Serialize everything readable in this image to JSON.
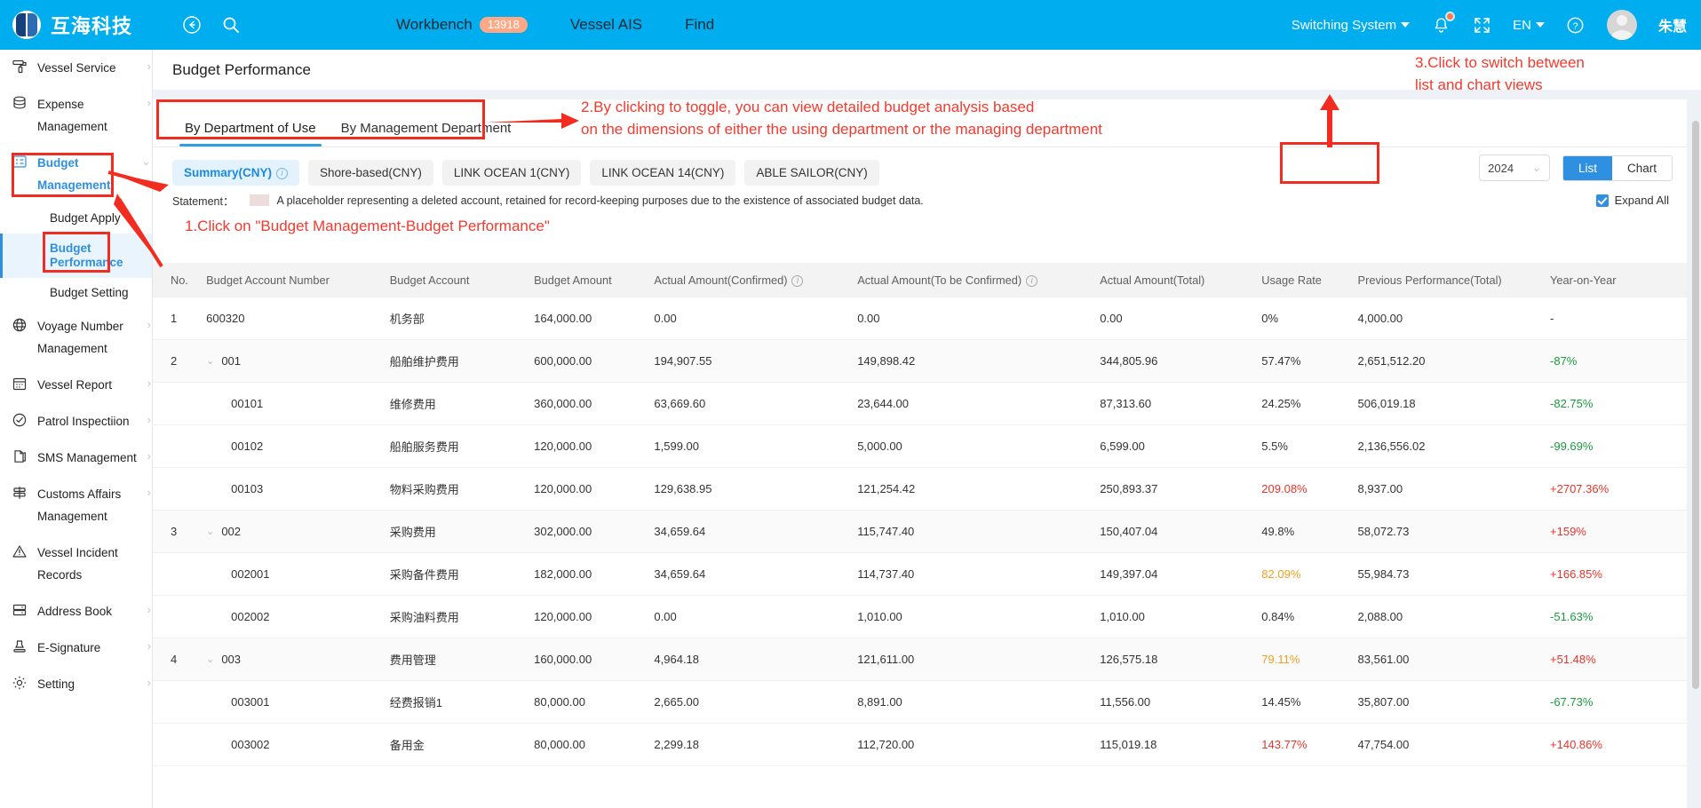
{
  "topbar": {
    "brand": "互海科技",
    "icons": [
      "back-circle-icon",
      "search-icon"
    ],
    "nav": [
      {
        "label": "Workbench",
        "badge": "13918"
      },
      {
        "label": "Vessel AIS"
      },
      {
        "label": "Find"
      }
    ],
    "switching_system": "Switching System",
    "language": "EN",
    "username": "朱慧",
    "accent": "#00AEEF",
    "badge_color": "#ffa887"
  },
  "sidebar": {
    "items": [
      {
        "label": "Vessel Service",
        "icon": "roller-icon",
        "arrow": "›"
      },
      {
        "label": "Expense Management",
        "icon": "database-icon",
        "arrow": "›"
      },
      {
        "label": "Budget Management",
        "icon": "grid-icon",
        "arrow": "⌄",
        "active": true
      },
      {
        "label": "Voyage Number Management",
        "icon": "globe-icon",
        "arrow": "›"
      },
      {
        "label": "Vessel Report",
        "icon": "calendar-icon",
        "arrow": "›"
      },
      {
        "label": "Patrol Inspectiion",
        "icon": "check-circle-icon",
        "arrow": "›"
      },
      {
        "label": "SMS Management",
        "icon": "document-icon",
        "arrow": "›"
      },
      {
        "label": "Customs Affairs Management",
        "icon": "signpost-icon",
        "arrow": "›"
      },
      {
        "label": "Vessel Incident Records",
        "icon": "warning-icon",
        "arrow": ""
      },
      {
        "label": "Address Book",
        "icon": "book-icon",
        "arrow": "›"
      },
      {
        "label": "E-Signature",
        "icon": "stamp-icon",
        "arrow": "›"
      },
      {
        "label": "Setting",
        "icon": "gear-icon",
        "arrow": "›"
      }
    ],
    "sub_items": [
      {
        "label": "Budget Apply",
        "selected": false
      },
      {
        "label": "Budget Performance",
        "selected": true
      },
      {
        "label": "Budget Setting",
        "selected": false
      }
    ]
  },
  "page": {
    "title": "Budget Performance",
    "tabs": [
      {
        "label": "By Department of Use",
        "active": true
      },
      {
        "label": "By Management Department",
        "active": false
      }
    ],
    "chips": [
      {
        "label": "Summary(CNY)",
        "active": true,
        "info": true
      },
      {
        "label": "Shore-based(CNY)",
        "active": false,
        "info": false
      },
      {
        "label": "LINK OCEAN 1(CNY)",
        "active": false,
        "info": false
      },
      {
        "label": "LINK OCEAN 14(CNY)",
        "active": false,
        "info": false
      },
      {
        "label": "ABLE SAILOR(CNY)",
        "active": false,
        "info": false
      }
    ],
    "year": "2024",
    "view_toggle": [
      {
        "label": "List",
        "active": true
      },
      {
        "label": "Chart",
        "active": false
      }
    ],
    "statement_label": "Statement：",
    "statement_text": "A placeholder representing a deleted account, retained for record-keeping purposes due to the existence of associated budget data.",
    "expand_all": "Expand All",
    "expand_all_checked": true
  },
  "table": {
    "headers": [
      "No.",
      "Budget Account Number",
      "Budget Account",
      "Budget Amount",
      "Actual Amount(Confirmed)",
      "Actual Amount(To be Confirmed)",
      "Actual Amount(Total)",
      "Usage Rate",
      "Previous Performance(Total)",
      "Year-on-Year"
    ],
    "header_info_cols": [
      4,
      5
    ],
    "rows": [
      {
        "no": "1",
        "number": "600320",
        "account": "机务部",
        "budget": "164,000.00",
        "confirmed": "0.00",
        "tobe": "0.00",
        "total": "0.00",
        "rate": "0%",
        "rate_color": "normal",
        "prev": "4,000.00",
        "yoy": "-",
        "yoy_color": "normal",
        "level": 0,
        "expandable": false,
        "shade": false
      },
      {
        "no": "2",
        "number": "001",
        "account": "船舶维护费用",
        "budget": "600,000.00",
        "confirmed": "194,907.55",
        "tobe": "149,898.42",
        "total": "344,805.96",
        "rate": "57.47%",
        "rate_color": "normal",
        "prev": "2,651,512.20",
        "yoy": "-87%",
        "yoy_color": "green",
        "level": 0,
        "expandable": true,
        "shade": true
      },
      {
        "no": "",
        "number": "00101",
        "account": "维修费用",
        "budget": "360,000.00",
        "confirmed": "63,669.60",
        "tobe": "23,644.00",
        "total": "87,313.60",
        "rate": "24.25%",
        "rate_color": "normal",
        "prev": "506,019.18",
        "yoy": "-82.75%",
        "yoy_color": "green",
        "level": 1,
        "expandable": false,
        "shade": false
      },
      {
        "no": "",
        "number": "00102",
        "account": "船舶服务费用",
        "budget": "120,000.00",
        "confirmed": "1,599.00",
        "tobe": "5,000.00",
        "total": "6,599.00",
        "rate": "5.5%",
        "rate_color": "normal",
        "prev": "2,136,556.02",
        "yoy": "-99.69%",
        "yoy_color": "green",
        "level": 1,
        "expandable": false,
        "shade": false
      },
      {
        "no": "",
        "number": "00103",
        "account": "物料采购费用",
        "budget": "120,000.00",
        "confirmed": "129,638.95",
        "tobe": "121,254.42",
        "total": "250,893.37",
        "rate": "209.08%",
        "rate_color": "red",
        "prev": "8,937.00",
        "yoy": "+2707.36%",
        "yoy_color": "red",
        "level": 1,
        "expandable": false,
        "shade": false
      },
      {
        "no": "3",
        "number": "002",
        "account": "采购费用",
        "budget": "302,000.00",
        "confirmed": "34,659.64",
        "tobe": "115,747.40",
        "total": "150,407.04",
        "rate": "49.8%",
        "rate_color": "normal",
        "prev": "58,072.73",
        "yoy": "+159%",
        "yoy_color": "red",
        "level": 0,
        "expandable": true,
        "shade": true
      },
      {
        "no": "",
        "number": "002001",
        "account": "采购备件费用",
        "budget": "182,000.00",
        "confirmed": "34,659.64",
        "tobe": "114,737.40",
        "total": "149,397.04",
        "rate": "82.09%",
        "rate_color": "orange",
        "prev": "55,984.73",
        "yoy": "+166.85%",
        "yoy_color": "red",
        "level": 1,
        "expandable": false,
        "shade": false
      },
      {
        "no": "",
        "number": "002002",
        "account": "采购油料费用",
        "budget": "120,000.00",
        "confirmed": "0.00",
        "tobe": "1,010.00",
        "total": "1,010.00",
        "rate": "0.84%",
        "rate_color": "normal",
        "prev": "2,088.00",
        "yoy": "-51.63%",
        "yoy_color": "green",
        "level": 1,
        "expandable": false,
        "shade": false
      },
      {
        "no": "4",
        "number": "003",
        "account": "费用管理",
        "budget": "160,000.00",
        "confirmed": "4,964.18",
        "tobe": "121,611.00",
        "total": "126,575.18",
        "rate": "79.11%",
        "rate_color": "orange",
        "prev": "83,561.00",
        "yoy": "+51.48%",
        "yoy_color": "red",
        "level": 0,
        "expandable": true,
        "shade": true
      },
      {
        "no": "",
        "number": "003001",
        "account": "经费报销1",
        "budget": "80,000.00",
        "confirmed": "2,665.00",
        "tobe": "8,891.00",
        "total": "11,556.00",
        "rate": "14.45%",
        "rate_color": "normal",
        "prev": "35,807.00",
        "yoy": "-67.73%",
        "yoy_color": "green",
        "level": 1,
        "expandable": false,
        "shade": false
      },
      {
        "no": "",
        "number": "003002",
        "account": "备用金",
        "budget": "80,000.00",
        "confirmed": "2,299.18",
        "tobe": "112,720.00",
        "total": "115,019.18",
        "rate": "143.77%",
        "rate_color": "red",
        "prev": "47,754.00",
        "yoy": "+140.86%",
        "yoy_color": "red",
        "level": 1,
        "expandable": false,
        "shade": false
      }
    ]
  },
  "annotations": {
    "note1": "1.Click on \"Budget Management-Budget Performance\"",
    "note2_line1": "2.By clicking to toggle, you can view detailed budget analysis based",
    "note2_line2": "on the dimensions of either the using department or the managing department",
    "note3_line1": "3.Click to switch between",
    "note3_line2": "list and chart views",
    "color": "#f33a2e"
  }
}
